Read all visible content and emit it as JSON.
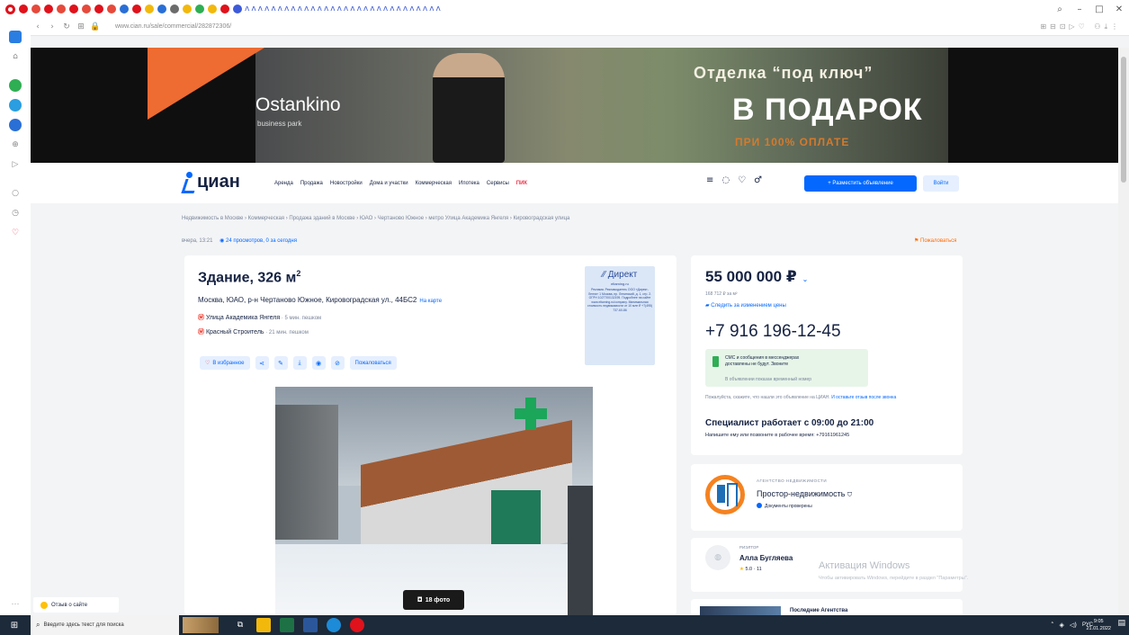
{
  "browser": {
    "tab_count_glyph": "ᴧ",
    "url": "www.cian.ru/sale/commercial/282872306/",
    "window_controls": [
      "–",
      "□",
      "✕"
    ],
    "search_glyph": "⌕"
  },
  "sidebar": {
    "more_label": "···"
  },
  "banner": {
    "logo": "Ostankino",
    "logo_sub": "business park",
    "headline_1": "Отделка “под ключ”",
    "headline_2": "В ПОДАРОК",
    "headline_3": "ПРИ 100% ОПЛАТЕ"
  },
  "header": {
    "brand": "циан",
    "nav": [
      "Аренда",
      "Продажа",
      "Новостройки",
      "Дома и участки",
      "Коммерческая",
      "Ипотека",
      "Сервисы"
    ],
    "nav_hot": "ПИК",
    "post_button": "+ Разместить объявление",
    "login_button": "Войти"
  },
  "breadcrumbs": "Недвижимость в Москве  ›  Коммерческая  ›  Продажа зданий в Москве  ›  ЮАО  ›  Чертаново Южное  ›  метро Улица Академика Янгеля  ›  Кировоградская улица",
  "meta": {
    "updated": "вчера, 13:21",
    "views": "24 просмотров, 0 за сегодня",
    "complain": "Пожаловаться"
  },
  "listing": {
    "title": "Здание, 326 м",
    "title_sup": "2",
    "address": "Москва, ЮАО, р-н Чертаново Южное, Кировоградская ул., 44БС2",
    "map_link": "На карте",
    "metro": [
      {
        "name": "Улица Академика Янгеля",
        "walk": " · 5 мин. пешком"
      },
      {
        "name": "Красный Строитель",
        "walk": " · 21 мин. пешком"
      }
    ],
    "favorite": "В избранное",
    "complain_btn": "Пожаловаться",
    "photo_count": "18 фото"
  },
  "ad": {
    "brand": "Директ",
    "site": "eltaming.ru",
    "text": "Реклама. Рекламодатель ООО «Директ-Лента» 1 Москва, пр. Ленинский, д. 1, стр. 2. ОГРН 1027700132195. Подробнее на сайте www.eltaming.ru/company. Минимальная стоимость недвижимости от 10 млн ₽ +7(495) 737-60-86"
  },
  "price": {
    "value": "55 000 000",
    "currency": "₽",
    "per_m2": "168 712 ₽ за м²",
    "watch": "Следить за изменением цены",
    "phone": "+7 916 196-12-45",
    "sms_line_1": "СМС и сообщения в мессенджерах",
    "sms_line_2": "доставлены не будут. Звоните",
    "sms_note": "В объявлении показан временный номер",
    "disclaimer": "Пожалуйста, скажите, что нашли это объявление на ЦИАН.",
    "disclaimer_link": "И оставьте отзыв после звонка",
    "hours": "Специалист работает с 09:00 до 21:00",
    "hours_hint": "Напишите ему или позвоните в рабочее время: +79161961245"
  },
  "agency": {
    "type": "АГЕНТСТВО НЕДВИЖИМОСТИ",
    "name": "Простор-недвижимость",
    "docs": "Документы проверены"
  },
  "realtor": {
    "type": "РИЭЛТОР",
    "name": "Алла Бугляева",
    "rating": "5.0 · 11"
  },
  "next_card": "Последние Агентства",
  "watermark": {
    "title": "Активация Windows",
    "hint": "Чтобы активировать Windows, перейдите в раздел \"Параметры\"."
  },
  "feedback": "Отзыв о сайте",
  "taskbar": {
    "search_placeholder": "Введите здесь текст для поиска",
    "lang": "РУС",
    "time": "9:05",
    "date": "21.01.2022"
  },
  "colors": {
    "brand_blue": "#0468ff",
    "metro_red": "#ee3124",
    "complain_orange": "#ff6b00"
  }
}
